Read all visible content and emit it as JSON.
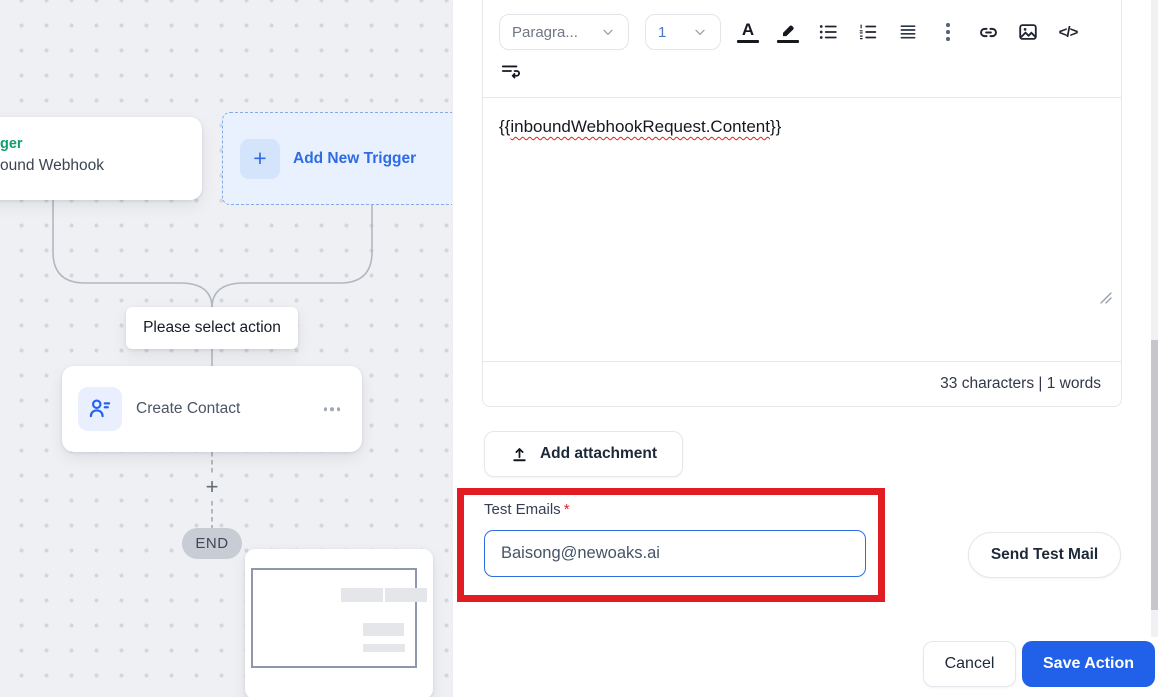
{
  "canvas": {
    "trigger_card": {
      "type_fragment": "ger",
      "name_fragment": "ound Webhook"
    },
    "add_new_trigger": {
      "plus": "+",
      "label": "Add New Trigger"
    },
    "select_action_hint": "Please select action",
    "create_contact": {
      "label": "Create Contact"
    },
    "add_step_plus": "+",
    "end_badge": "END"
  },
  "editor": {
    "toolbar": {
      "paragraph_style": "Paragra...",
      "font_size": "1",
      "text_color_glyph": "A",
      "code_glyph": "</>"
    },
    "body": {
      "prefix": "{{",
      "variable": "inboundWebhookRequest.Content",
      "suffix": "}}"
    },
    "stats": "33 characters | 1 words"
  },
  "attachment_button": "Add attachment",
  "test_emails": {
    "label": "Test Emails",
    "required": "*",
    "value": "Baisong@newoaks.ai"
  },
  "send_test_mail": "Send Test Mail",
  "actions": {
    "cancel": "Cancel",
    "save": "Save Action"
  },
  "colors": {
    "accent_blue": "#2160e8",
    "annotation_red": "#e11d23",
    "trigger_green": "#0e9f6f",
    "canvas_bg": "#eef0f3",
    "input_border_blue": "#2f6fe3"
  },
  "icons": {
    "toolbar": [
      "text-color",
      "highlight",
      "bullet-list",
      "ordered-list",
      "align-justify",
      "more-options",
      "insert-link",
      "insert-image",
      "code-view",
      "text-wrap"
    ],
    "attachment": "upload-icon",
    "create_contact": "contact-person-icon"
  }
}
